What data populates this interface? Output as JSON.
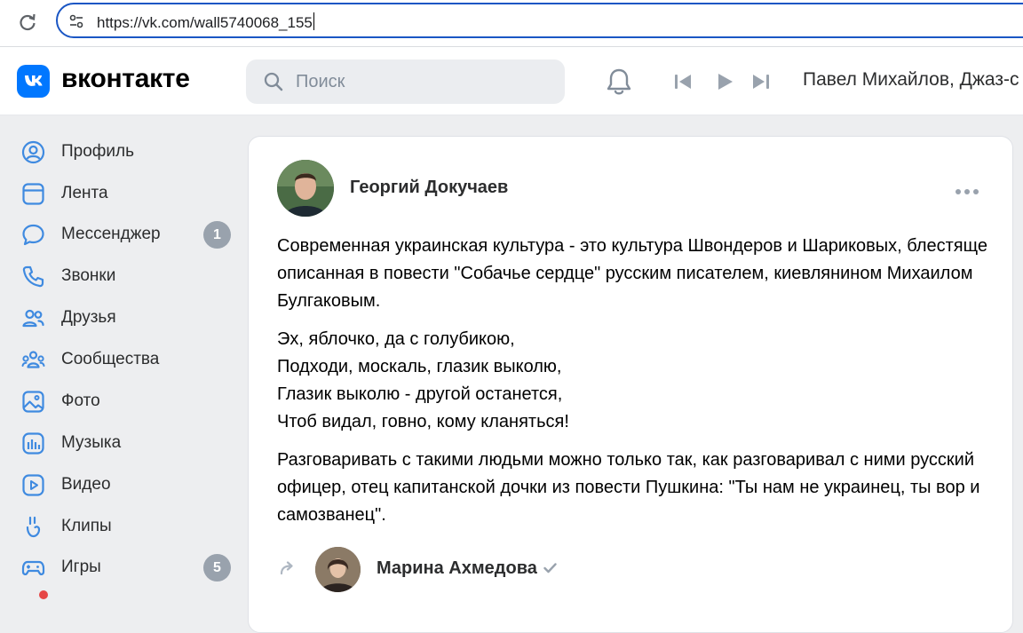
{
  "browser": {
    "url": "https://vk.com/wall5740068_155"
  },
  "header": {
    "wordmark": "вконтакте",
    "search_placeholder": "Поиск",
    "track_title": "Павел Михайлов, Джаз-с"
  },
  "sidebar": {
    "items": [
      {
        "label": "Профиль",
        "icon": "profile-icon"
      },
      {
        "label": "Лента",
        "icon": "feed-icon"
      },
      {
        "label": "Мессенджер",
        "icon": "messenger-icon",
        "badge": "1"
      },
      {
        "label": "Звонки",
        "icon": "phone-icon"
      },
      {
        "label": "Друзья",
        "icon": "friends-icon"
      },
      {
        "label": "Сообщества",
        "icon": "communities-icon"
      },
      {
        "label": "Фото",
        "icon": "photo-icon"
      },
      {
        "label": "Музыка",
        "icon": "music-icon"
      },
      {
        "label": "Видео",
        "icon": "video-icon"
      },
      {
        "label": "Клипы",
        "icon": "clips-icon"
      },
      {
        "label": "Игры",
        "icon": "games-icon",
        "badge": "5"
      }
    ]
  },
  "post": {
    "author": "Георгий Докучаев",
    "paragraph1": "Современная украинская культура - это культура Швондеров и Шариковых, блестяще описанная в повести \"Собачье сердце\" русским писателем, киевлянином Михаилом Булгаковым.",
    "verse": [
      "Эх, яблочко, да с голубикою,",
      "Подходи, москаль, глазик выколю,",
      "Глазик выколю - другой останется,",
      "Чтоб видал, говно, кому кланяться!"
    ],
    "paragraph2": "Разговаривать с такими людьми можно только так, как разговаривал с ними русский офицер, отец капитанской дочки из повести Пушкина: \"Ты нам не украинец, ты вор и самозванец\".",
    "repost_author": "Марина Ахмедова"
  },
  "colors": {
    "accent": "#0077ff",
    "badge": "#99a2ad",
    "background": "#edeef0"
  }
}
